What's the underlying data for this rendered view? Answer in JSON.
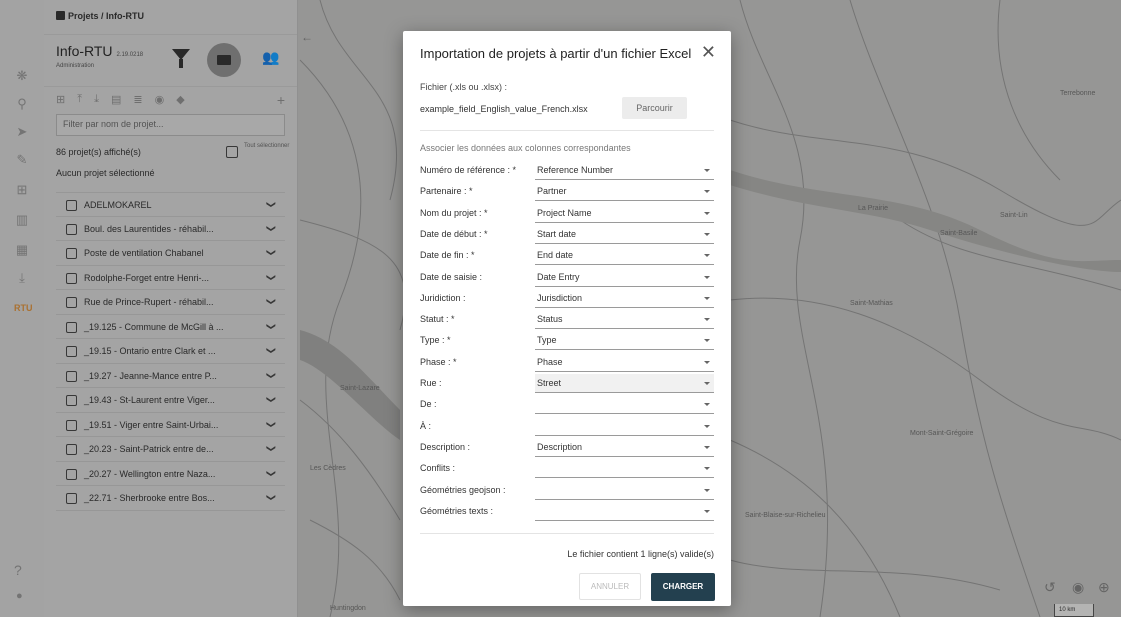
{
  "panel": {
    "breadcrumb": "Projets / Info-RTU",
    "app_name": "Info-RTU",
    "app_version": "2.19.0218",
    "app_role": "Administration",
    "search_placeholder": "Filter par nom de projet...",
    "count": "86 projet(s) affiché(s)",
    "select_all": "Tout sélectionner",
    "none_selected": "Aucun projet sélectionné",
    "projects": [
      "ADELMOKAREL",
      "Boul. des Laurentides - réhabil...",
      "Poste de ventilation Chabanel",
      "Rodolphe-Forget entre Henri-...",
      "Rue de Prince-Rupert - réhabil...",
      "_19.125 - Commune de McGill à ...",
      "_19.15 - Ontario entre Clark et ...",
      "_19.27 - Jeanne-Mance entre P...",
      "_19.43 - St-Laurent entre Viger...",
      "_19.51 - Viger entre Saint-Urbai...",
      "_20.23 - Saint-Patrick entre de...",
      "_20.27 - Wellington entre Naza...",
      "_22.71 - Sherbrooke entre Bos..."
    ]
  },
  "map": {
    "labels": [
      "Saint-Lazare",
      "Les Cèdres",
      "La Prairie",
      "Saint-Mathias",
      "Saint-Basile",
      "Mont-Saint-Grégoire",
      "Saint-Blaise-sur-Richelieu",
      "Huntingdon",
      "Saint-Lin",
      "Terrebonne"
    ],
    "scale": "10 km"
  },
  "modal": {
    "title": "Importation de projets à partir d'un fichier Excel",
    "file_label": "Fichier (.xls ou .xlsx) :",
    "file_name": "example_field_English_value_French.xlsx",
    "browse": "Parcourir",
    "assoc": "Associer les données aux colonnes correspondantes",
    "fields": [
      {
        "label": "Numéro de référence : *",
        "value": "Reference Number"
      },
      {
        "label": "Partenaire : *",
        "value": "Partner"
      },
      {
        "label": "Nom du projet : *",
        "value": "Project Name"
      },
      {
        "label": "Date de début : *",
        "value": "Start date"
      },
      {
        "label": "Date de fin : *",
        "value": "End date"
      },
      {
        "label": "Date de saisie :",
        "value": "Date Entry"
      },
      {
        "label": "Juridiction :",
        "value": "Jurisdiction"
      },
      {
        "label": "Statut : *",
        "value": "Status"
      },
      {
        "label": "Type : *",
        "value": "Type"
      },
      {
        "label": "Phase : *",
        "value": "Phase"
      },
      {
        "label": "Rue :",
        "value": "Street"
      },
      {
        "label": "De :",
        "value": ""
      },
      {
        "label": "À :",
        "value": ""
      },
      {
        "label": "Description :",
        "value": "Description"
      },
      {
        "label": "Conflits :",
        "value": ""
      },
      {
        "label": "Géométries geojson :",
        "value": ""
      },
      {
        "label": "Géométries texts :",
        "value": ""
      }
    ],
    "status": "Le fichier contient 1 ligne(s) valide(s)",
    "cancel": "ANNULER",
    "load": "CHARGER"
  }
}
